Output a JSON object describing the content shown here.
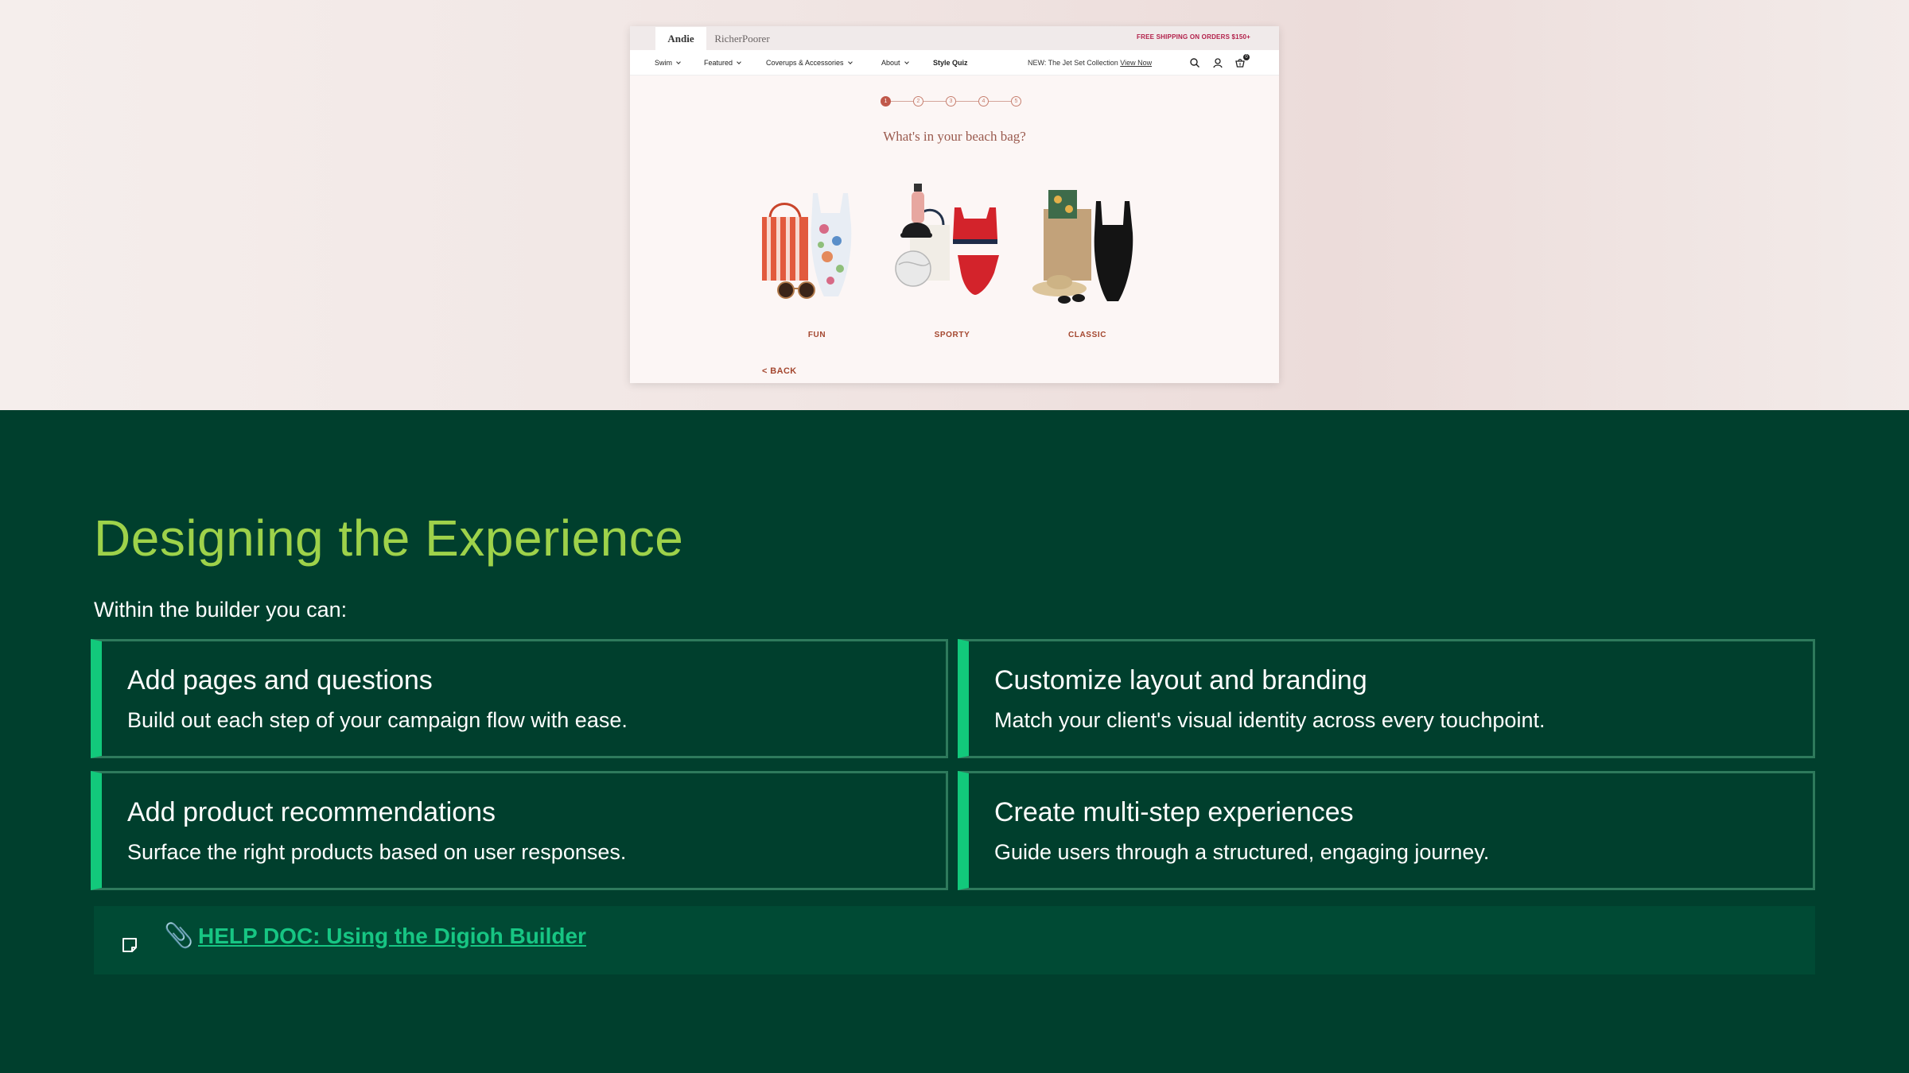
{
  "preview": {
    "brands": [
      "Andie",
      "RicherPoorer"
    ],
    "shipping_banner": "FREE SHIPPING ON ORDERS $150+",
    "nav": [
      {
        "label": "Swim",
        "has_dropdown": true
      },
      {
        "label": "Featured",
        "has_dropdown": true
      },
      {
        "label": "Coverups & Accessories",
        "has_dropdown": true
      },
      {
        "label": "About",
        "has_dropdown": true
      },
      {
        "label": "Style Quiz",
        "has_dropdown": false
      }
    ],
    "promo_text": "NEW: The Jet Set Collection",
    "promo_link": "View Now",
    "icons": [
      "search-icon",
      "account-icon",
      "cart-icon"
    ],
    "cart_count": "0",
    "steps": [
      "1",
      "2",
      "3",
      "4",
      "5"
    ],
    "active_step": 1,
    "question": "What's in your beach bag?",
    "options": [
      {
        "label": "FUN"
      },
      {
        "label": "SPORTY"
      },
      {
        "label": "CLASSIC"
      }
    ],
    "back_label": "< BACK"
  },
  "content": {
    "title": "Designing the Experience",
    "intro": "Within the builder you can:",
    "cards": [
      {
        "title": "Add pages and questions",
        "desc": "Build out each step of your campaign flow with ease."
      },
      {
        "title": "Customize layout and branding",
        "desc": "Match your client's visual identity across every touchpoint."
      },
      {
        "title": "Add product recommendations",
        "desc": "Surface the right products based on user responses."
      },
      {
        "title": "Create multi-step experiences",
        "desc": "Guide users through a structured, engaging journey."
      }
    ],
    "help_link": "HELP DOC: Using the Digioh Builder"
  },
  "colors": {
    "background": "#003f2d",
    "title": "#9ed24a",
    "accent": "#12c97b",
    "card_border": "#2e7a5c",
    "link": "#17c583",
    "quiz_accent": "#a4472f"
  }
}
